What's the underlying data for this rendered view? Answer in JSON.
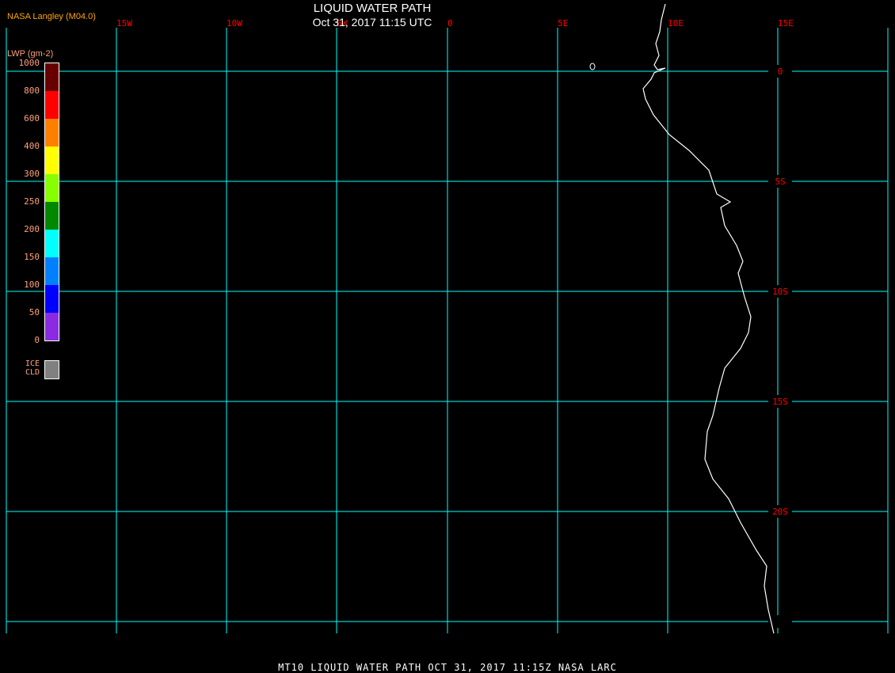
{
  "header": {
    "title": "LIQUID WATER PATH",
    "datetime": "Oct 31, 2017 11:15 UTC",
    "source": "NASA Langley (M04.0)"
  },
  "map": {
    "longitude_labels": [
      "15W",
      "10W",
      "5W",
      "0",
      "5E",
      "10E",
      "15E"
    ],
    "latitude_labels": [
      "0",
      "5S",
      "10S",
      "15S",
      "20S"
    ],
    "grid_color": "#00ffff",
    "label_color": "#ff0000",
    "coastline_color": "#ffffff",
    "background": "#000000"
  },
  "legend": {
    "title": "LWP (gm-2)",
    "ticks": [
      "1000",
      "800",
      "600",
      "400",
      "300",
      "250",
      "200",
      "150",
      "100",
      "50",
      "0"
    ],
    "colors": [
      "#660000",
      "#ff0000",
      "#ff8000",
      "#ffff00",
      "#88ff00",
      "#008800",
      "#00ffff",
      "#0080ff",
      "#0000ff",
      "#8a2be2"
    ],
    "ice_label_1": "ICE",
    "ice_label_2": "CLD",
    "ice_color": "#808080"
  },
  "footer": {
    "text": "MT10  LIQUID WATER PATH   OCT 31, 2017 11:15Z   NASA LARC"
  }
}
